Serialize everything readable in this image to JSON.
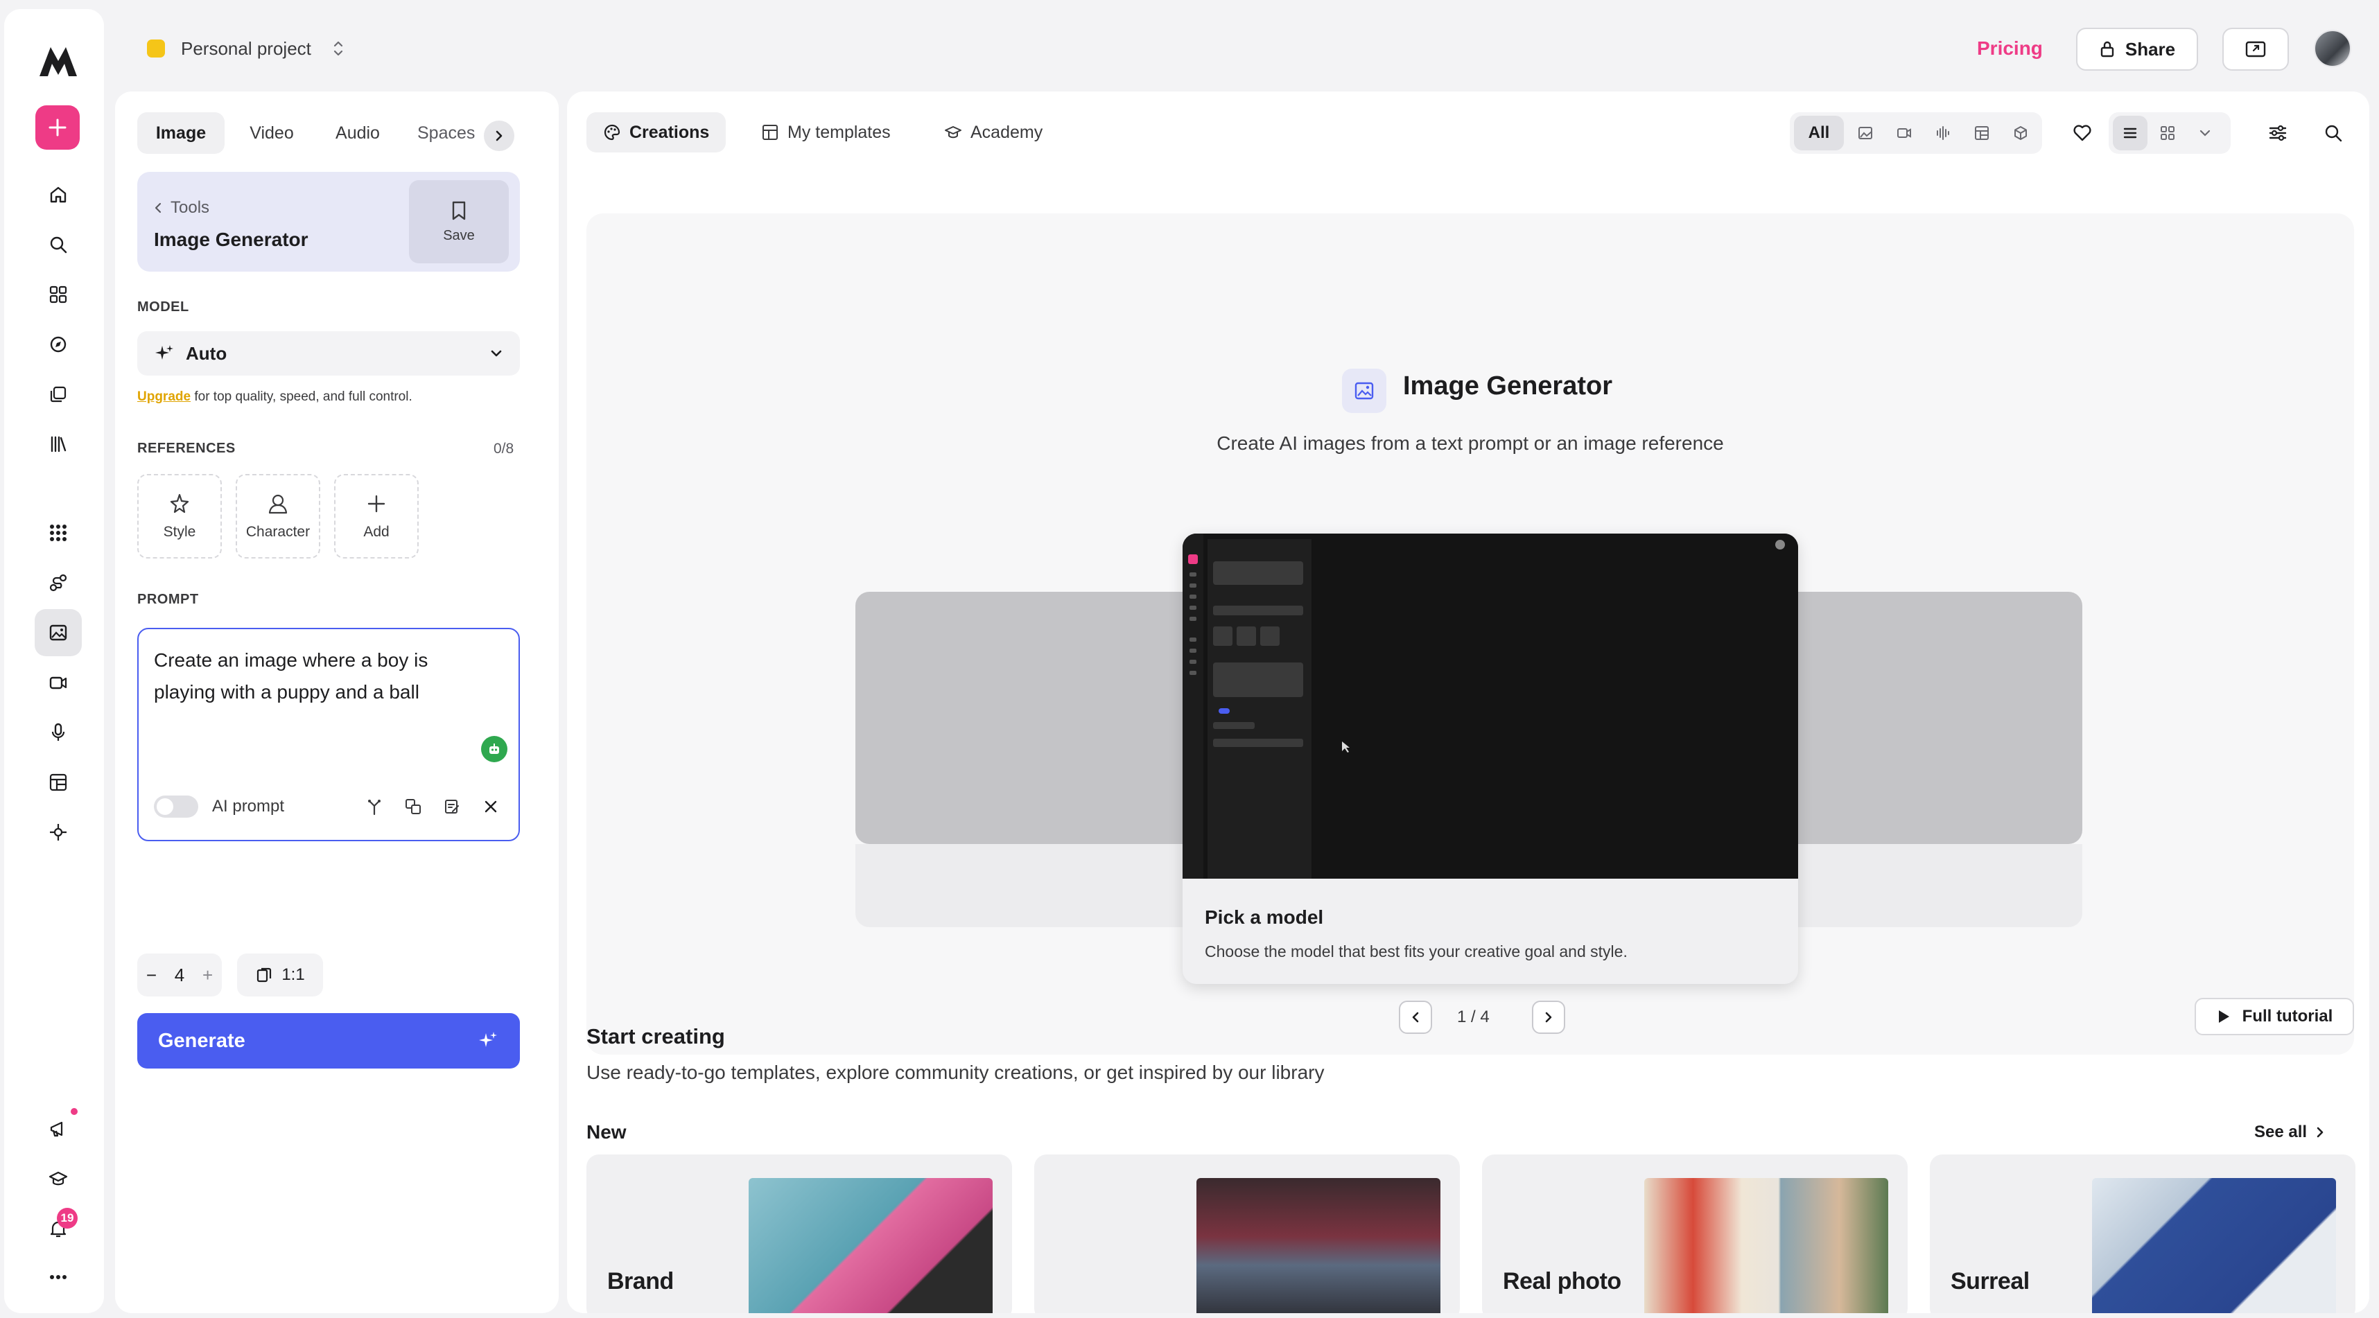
{
  "project": {
    "name": "Personal project"
  },
  "topbar": {
    "pricing": "Pricing",
    "share": "Share"
  },
  "panel": {
    "tabs": [
      "Image",
      "Video",
      "Audio",
      "Spaces"
    ],
    "breadcrumb": "Tools",
    "tool_title": "Image Generator",
    "save": "Save",
    "model_label": "MODEL",
    "model_value": "Auto",
    "upgrade_link": "Upgrade",
    "upgrade_text": " for top quality, speed, and full control.",
    "references_label": "REFERENCES",
    "references_count": "0/8",
    "reference_options": [
      "Style",
      "Character",
      "Add"
    ],
    "prompt_label": "PROMPT",
    "prompt_text": "Create an image where a boy is playing with a puppy and a ball",
    "ai_prompt": "AI prompt",
    "quantity": "4",
    "minus": "−",
    "plus": "+",
    "ratio": "1:1",
    "generate": "Generate"
  },
  "main": {
    "tabs": [
      "Creations",
      "My templates",
      "Academy"
    ],
    "filter_all": "All",
    "hero": {
      "title": "Image Generator",
      "subtitle": "Create AI images from a text prompt or an image reference",
      "slide_title": "Pick a model",
      "slide_desc": "Choose the model that best fits your creative goal and style.",
      "pager": "1 / 4",
      "tutorial": "Full tutorial"
    },
    "start": {
      "title": "Start creating",
      "subtitle": "Use ready-to-go templates, explore community creations, or get inspired by our library"
    },
    "new_label": "New",
    "see_all": "See all",
    "cards": [
      "Brand",
      "",
      "Real photo",
      "Surreal"
    ]
  },
  "notifications": {
    "count": "19"
  },
  "colors": {
    "accent": "#4a5df0",
    "brand_pink": "#ee3b86",
    "project_dot": "#f5c518"
  }
}
